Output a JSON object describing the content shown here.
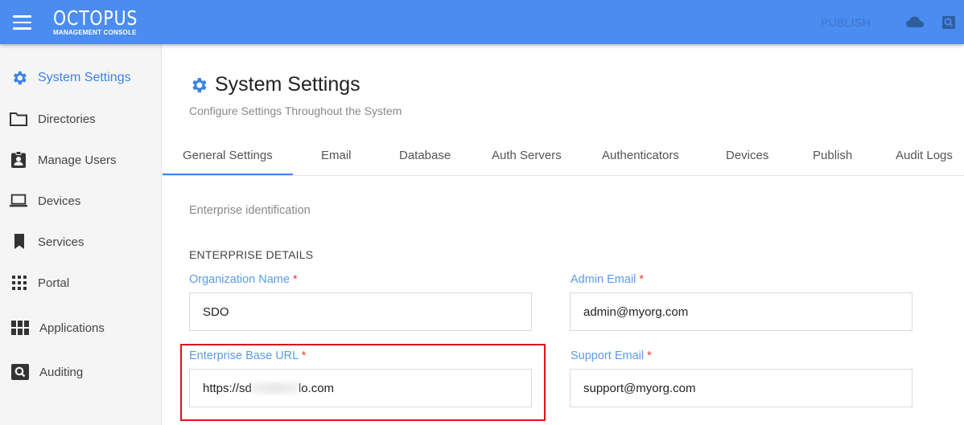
{
  "header": {
    "logo_title": "OCTOPUS",
    "logo_subtitle": "MANAGEMENT CONSOLE",
    "publish_label": "PUBLISH",
    "accent_color": "#4a8cf0"
  },
  "sidebar": {
    "items": [
      {
        "label": "System Settings",
        "icon": "gear-icon",
        "active": true
      },
      {
        "label": "Directories",
        "icon": "folder-icon"
      },
      {
        "label": "Manage Users",
        "icon": "user-badge-icon"
      },
      {
        "label": "Devices",
        "icon": "laptop-icon"
      },
      {
        "label": "Services",
        "icon": "bookmark-icon"
      },
      {
        "label": "Portal",
        "icon": "grid-dots-icon"
      },
      {
        "label": "Applications",
        "icon": "grid-squares-icon"
      },
      {
        "label": "Auditing",
        "icon": "search-box-icon"
      }
    ]
  },
  "main": {
    "title": "System Settings",
    "subtitle": "Configure Settings Throughout the System",
    "tabs": [
      {
        "label": "General Settings",
        "active": true
      },
      {
        "label": "Email"
      },
      {
        "label": "Database"
      },
      {
        "label": "Auth Servers"
      },
      {
        "label": "Authenticators"
      },
      {
        "label": "Devices"
      },
      {
        "label": "Publish"
      },
      {
        "label": "Audit Logs"
      }
    ],
    "section_label": "Enterprise identification",
    "section_title": "ENTERPRISE DETAILS",
    "fields": {
      "org_name": {
        "label": "Organization Name",
        "required": "*",
        "value": "SDO"
      },
      "admin_email": {
        "label": "Admin Email",
        "required": "*",
        "value": "admin@myorg.com"
      },
      "base_url": {
        "label": "Enterprise Base URL",
        "required": "*",
        "value_start": "https://sd",
        "value_end": "lo.com"
      },
      "support_email": {
        "label": "Support Email",
        "required": "*",
        "value": "support@myorg.com"
      }
    }
  }
}
